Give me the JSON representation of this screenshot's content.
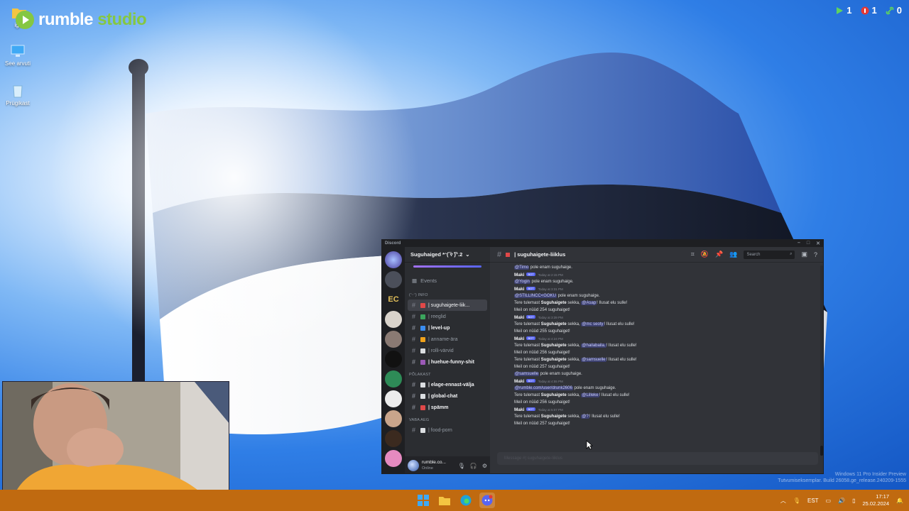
{
  "desktop": {
    "icons": [
      {
        "label": "igor"
      },
      {
        "label": "See arvuti"
      },
      {
        "label": "Prügikast"
      }
    ]
  },
  "rumble": {
    "brand": "rumble",
    "studio": "studio",
    "counters": [
      {
        "icon": "play-icon",
        "value": "1",
        "color": "#5fd35f"
      },
      {
        "icon": "live-icon",
        "value": "1",
        "color": "#e53935"
      },
      {
        "icon": "link-icon",
        "value": "0",
        "color": "#5fd35f"
      }
    ]
  },
  "discord": {
    "window_title": "Discord",
    "guild": "Suguhaiged *ᵔ(͡ ▿ ͡)ᵔ.2",
    "events": "Events",
    "categories": [
      "(ᵔᵕᵔ) INFO",
      "PÕLAKAST",
      "VABA AEG"
    ],
    "channels": [
      {
        "name": "| suguhaigete-liik...",
        "style": "selected",
        "color": "#e04848"
      },
      {
        "name": "| reeglid",
        "style": "dim",
        "color": "#3ba55d"
      },
      {
        "name": "| level-up",
        "style": "bright",
        "color": "#3a8df0"
      },
      {
        "name": "| anname-ära",
        "style": "dim",
        "color": "#f0a21b"
      },
      {
        "name": "| rolli-värvid",
        "style": "dim",
        "color": "#dbdee1"
      },
      {
        "name": "| huehue-funny-shit",
        "style": "bright",
        "color": "#9b59b6"
      },
      {
        "name": "| elage-ennast-välja",
        "style": "bright",
        "color": "#dbdee1"
      },
      {
        "name": "| global-chat",
        "style": "bright",
        "color": "#dbdee1"
      },
      {
        "name": "| spämm",
        "style": "bright",
        "color": "#e04848"
      },
      {
        "name": "| food-porn",
        "style": "dim",
        "color": "#dbdee1"
      }
    ],
    "user": {
      "name": "rumble.co...",
      "status": "Online"
    },
    "channel_title": "| suguhaigete-liiklus",
    "search_placeholder": "Search",
    "composer_placeholder": "Message #| suguhaigete-liiklus",
    "messages": [
      {
        "kind": "text",
        "mention": "@Timo",
        "text": " pole enam suguhaige."
      },
      {
        "kind": "head",
        "author": "Maki",
        "badge": "BOT",
        "time": "Today at 2:15 PM"
      },
      {
        "kind": "text",
        "mention": "@Yogin",
        "text": " pole enam suguhaige."
      },
      {
        "kind": "head",
        "author": "Maki",
        "badge": "BOT",
        "time": "Today at 3:31 PM"
      },
      {
        "kind": "text",
        "mention": "@STILLINCC<GOKU",
        "text": " pole enam suguhaige."
      },
      {
        "kind": "welcome",
        "pre": "Tere tulemast ",
        "bold": "Suguhaigete",
        "mid": " sekka, ",
        "mention": "@Asap",
        "post": "! Ilusat elu sulle!"
      },
      {
        "kind": "plain",
        "text": "Meil on nüüd 254 suguhaiget!"
      },
      {
        "kind": "head",
        "author": "Maki",
        "badge": "BOT",
        "time": "Today at 3:39 PM"
      },
      {
        "kind": "welcome",
        "pre": "Tere tulemast ",
        "bold": "Suguhaigete",
        "mid": " sekka, ",
        "mention": "@mc seoty",
        "post": "! Ilusat elu sulle!"
      },
      {
        "kind": "plain",
        "text": "Meil on nüüd 255 suguhaiget!"
      },
      {
        "kind": "head",
        "author": "Maki",
        "badge": "BOT",
        "time": "Today at 4:24 PM"
      },
      {
        "kind": "welcome",
        "pre": "Tere tulemast ",
        "bold": "Suguhaigete",
        "mid": " sekka, ",
        "mention": "@hailabaila.",
        "post": "! Ilusat elu sulle!"
      },
      {
        "kind": "plain",
        "text": "Meil on nüüd 256 suguhaiget!"
      },
      {
        "kind": "welcome",
        "pre": "Tere tulemast ",
        "bold": "Suguhaigete",
        "mid": " sekka, ",
        "mention": "@samsuelle",
        "post": "! Ilusat elu sulle!"
      },
      {
        "kind": "plain",
        "text": "Meil on nüüd 257 suguhaiget!"
      },
      {
        "kind": "text",
        "mention": "@samsuelle",
        "text": " pole enam suguhaige."
      },
      {
        "kind": "head",
        "author": "Maki",
        "badge": "BOT",
        "time": "Today at 4:55 PM"
      },
      {
        "kind": "text",
        "mention": "@rumble.com/user/drunk2606",
        "text": " pole enam suguhaige."
      },
      {
        "kind": "welcome",
        "pre": "Tere tulemast ",
        "bold": "Suguhaigete",
        "mid": " sekka, ",
        "mention": "@Lilleke",
        "post": "! Ilusat elu sulle!"
      },
      {
        "kind": "plain",
        "text": "Meil on nüüd 256 suguhaiget!"
      },
      {
        "kind": "head",
        "author": "Maki",
        "badge": "BOT",
        "time": "Today at 5:07 PM"
      },
      {
        "kind": "welcome",
        "pre": "Tere tulemast ",
        "bold": "Suguhaigete",
        "mid": " sekka, ",
        "mention": "@?",
        "post": "! Ilusat elu sulle!"
      },
      {
        "kind": "plain",
        "text": "Meil on nüüd 257 suguhaiget!"
      }
    ]
  },
  "watermark": {
    "line1": "Windows 11 Pro Insider Preview",
    "line2": "Tutvumiseksemplar. Build 26058.ge_release.240209-1555"
  },
  "taskbar": {
    "language": "EST",
    "time": "17:17",
    "date": "25.02.2024",
    "apps": [
      "windows-start-icon",
      "file-explorer-icon",
      "edge-icon",
      "discord-icon"
    ]
  }
}
